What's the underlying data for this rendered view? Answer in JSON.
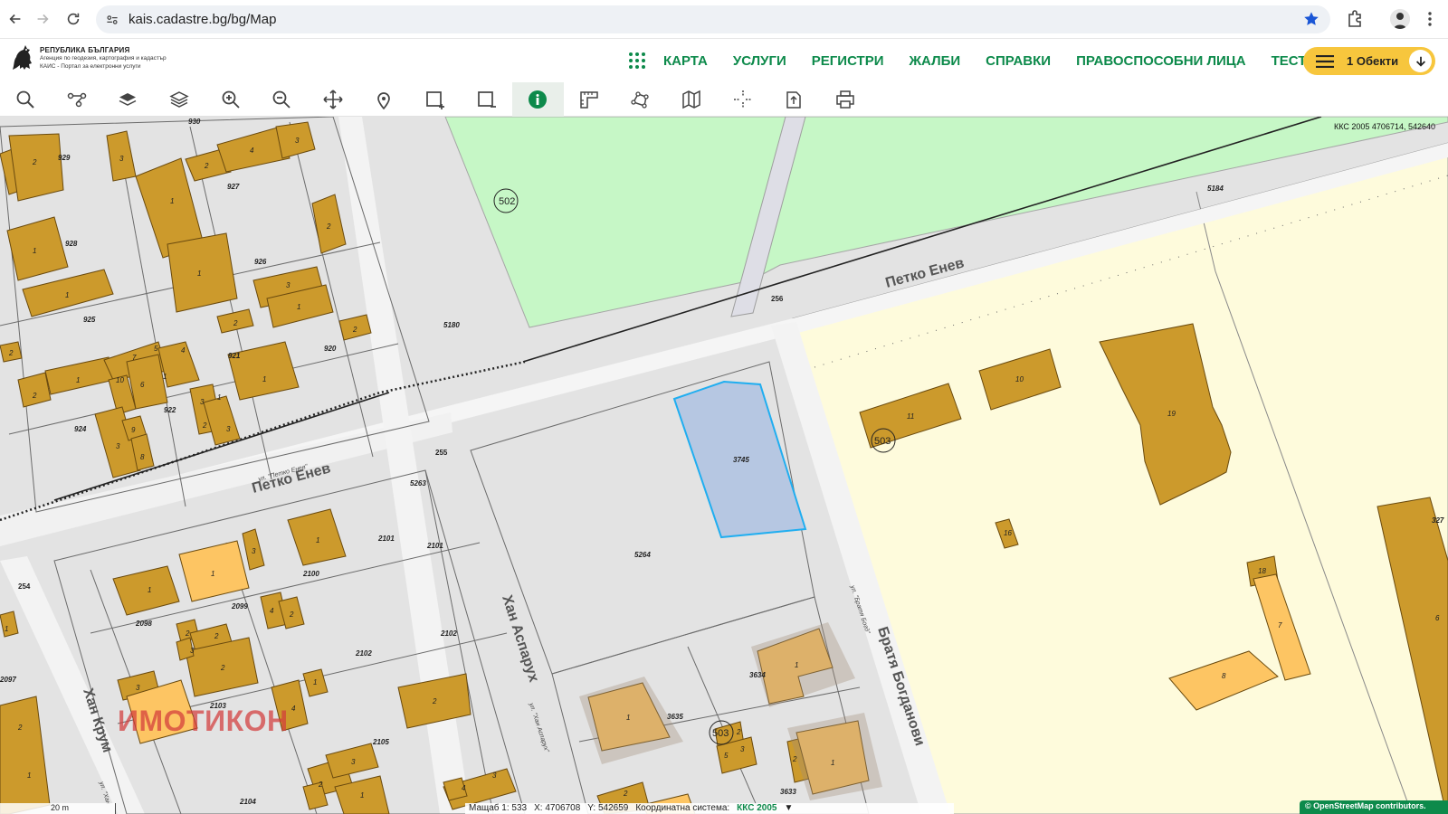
{
  "browser": {
    "url": "kais.cadastre.bg/bg/Map"
  },
  "header": {
    "logo_line1": "РЕПУБЛИКА БЪЛГАРИЯ",
    "logo_line2": "Агенция по геодезия, картография и кадастър",
    "logo_line3": "КАИС - Портал за електронни услуги",
    "nav": [
      "КАРТА",
      "УСЛУГИ",
      "РЕГИСТРИ",
      "ЖАЛБИ",
      "СПРАВКИ",
      "ПРАВОСПОСОБНИ ЛИЦА",
      "ТЕСТ"
    ],
    "objects_label": "1 Обекти"
  },
  "toolbar": {
    "tools": [
      "search-icon",
      "route-icon",
      "layer-icon",
      "layers-icon",
      "zoom-in-icon",
      "zoom-out-icon",
      "pan-icon",
      "pin-icon",
      "select-add-icon",
      "select-remove-icon",
      "info-icon",
      "measure-icon",
      "polygon-icon",
      "map-icon",
      "crosshair-icon",
      "export-icon",
      "print-icon"
    ],
    "active_tool": "info-icon"
  },
  "map": {
    "coord_readout": "ККС 2005 4706714, 542640",
    "watermark": "ИМОТИКОН",
    "streets": {
      "petko_enev_1": "Петко Енев",
      "petko_enev_2": "Петко Енев",
      "han_asparuh": "Хан Аспарух",
      "bratya_bogdanovi": "Братя Богданови",
      "han_krum": "Хан Крум",
      "small_petko": "ул. \"Петко Енев\"",
      "small_asparuh": "ул. \"Хан Аспарух\"",
      "small_bratya": "ул. \"Братя Богд\"",
      "small_krum": "ул. \"Хан"
    },
    "parcels": {
      "p502": "502",
      "p503a": "503",
      "p503b": "503",
      "p256": "256",
      "p255": "255",
      "p254": "254",
      "p5180": "5180",
      "p5184": "5184",
      "p5263": "5263",
      "p5264": "5264",
      "p3745": "3745",
      "p3634": "3634",
      "p3635": "3635",
      "p3633": "3633",
      "p2101a": "2101",
      "p2101b": "2101",
      "p2100": "2100",
      "p2099": "2099",
      "p2098": "2098",
      "p2102": "2102",
      "p2103": "2103",
      "p2104": "2104",
      "p2105": "2105",
      "p2102b": "2102",
      "p2097": "2097",
      "p930": "930",
      "p929": "929",
      "p928": "928",
      "p927": "927",
      "p926": "926",
      "p925": "925",
      "p924": "924",
      "p922": "922",
      "p921": "921",
      "p920": "920",
      "p327": "327"
    }
  },
  "status": {
    "scale_bar": "20 m",
    "scale": "Мащаб 1: 533",
    "x": "X: 4706708",
    "y": "Y: 542659",
    "crs_label": "Координатна система:",
    "crs_value": "ККС 2005",
    "osm": "© OpenStreetMap contributors."
  }
}
